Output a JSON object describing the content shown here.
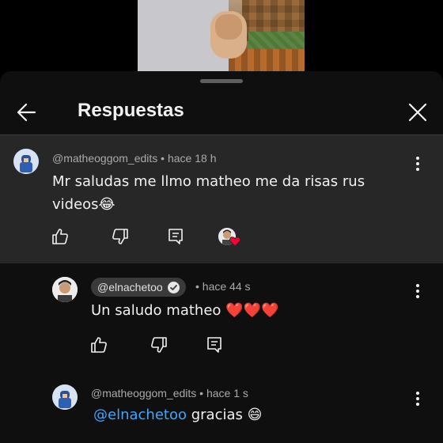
{
  "header": {
    "title": "Respuestas"
  },
  "comments": [
    {
      "author": "@matheoggom_edits",
      "separator": " • ",
      "time": "hace 18 h",
      "line1": "Mr saludas me llmo  matheo me da risas rus",
      "line2": "videos😂",
      "has_creator_heart": true
    },
    {
      "author": "@elnachetoo",
      "separator": " • ",
      "time": "hace 44 s",
      "text": "Un saludo matheo ❤️❤️❤️",
      "is_creator": true
    },
    {
      "author": "@matheoggom_edits",
      "separator": " • ",
      "time": "hace 1 s",
      "mention": "@elnachetoo",
      "text": " gracias 😄"
    }
  ],
  "icons": {
    "back": "arrow-left-icon",
    "close": "close-icon",
    "like": "thumb-up-icon",
    "dislike": "thumb-down-icon",
    "reply": "reply-icon",
    "more": "more-vert-icon",
    "heart": "creator-heart-icon",
    "verified": "verified-check-icon"
  },
  "colors": {
    "sheet_bg": "#0f0f0f",
    "highlight_bg": "#272727",
    "mention": "#3ea6ff",
    "heart": "#ff0033"
  }
}
